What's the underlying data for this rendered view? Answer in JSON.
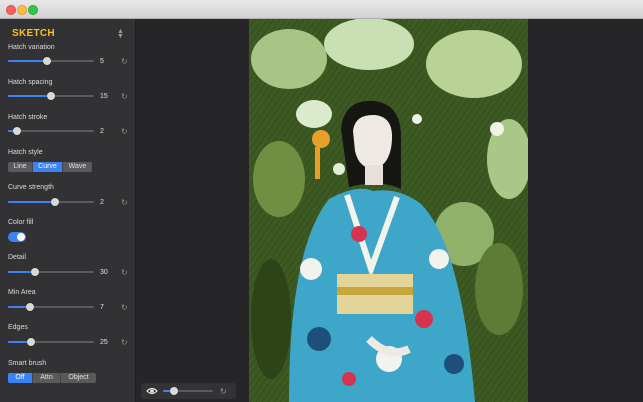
{
  "window": {
    "buttons": [
      "close",
      "minimize",
      "maximize"
    ]
  },
  "panel": {
    "title": "SKETCH",
    "selector_icon": "up-down-chevron-icon"
  },
  "controls": {
    "hatch_variation": {
      "label": "Hatch variation",
      "value": "5",
      "level": 0.45
    },
    "hatch_spacing": {
      "label": "Hatch spacing",
      "value": "15",
      "level": 0.5
    },
    "hatch_stroke": {
      "label": "Hatch stroke",
      "value": "2",
      "level": 0.1
    },
    "hatch_style": {
      "label": "Hatch style",
      "options": [
        "Line",
        "Curve",
        "Wave"
      ],
      "selected": "Curve"
    },
    "curve_strength": {
      "label": "Curve strength",
      "value": "2",
      "level": 0.55
    },
    "color_fill": {
      "label": "Color fill",
      "on": true
    },
    "detail": {
      "label": "Detail",
      "value": "30",
      "level": 0.31
    },
    "min_area": {
      "label": "Min Area",
      "value": "7",
      "level": 0.26
    },
    "edges": {
      "label": "Edges",
      "value": "25",
      "level": 0.27
    },
    "smart_brush": {
      "label": "Smart brush",
      "options": [
        "Off",
        "Attn",
        "Object"
      ],
      "selected": "Off"
    }
  },
  "view_bar": {
    "eye_icon": "eye-icon",
    "opacity_level": 0.22,
    "reset_icon": "reset-icon"
  },
  "colors": {
    "accent": "#3b82f6",
    "title": "#f6c21b",
    "sidebar_bg": "#323234",
    "canvas_bg": "#262628"
  }
}
